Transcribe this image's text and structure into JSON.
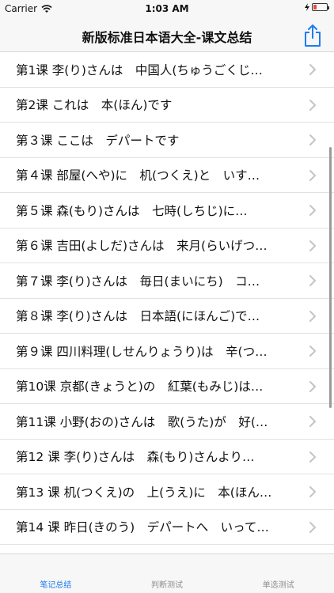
{
  "status": {
    "carrier": "Carrier",
    "time": "1:03 AM"
  },
  "header": {
    "title": "新版标准日本语大全-课文总结",
    "share_icon": "share-icon"
  },
  "lessons": [
    "第1课 李(り)さんは　中国人(ちゅうごくじ…",
    "第2课 これは　本(ほん)です",
    "第３课 ここは　デパートです",
    "第４课 部屋(へや)に　机(つくえ)と　いす…",
    "第５课 森(もり)さんは　七時(しちじ)に…",
    "第６课 吉田(よしだ)さんは　来月(らいげつ…",
    "第７课 李(り)さんは　毎日(まいにち)　コ…",
    "第８课 李(り)さんは　日本語(にほんご)で…",
    "第９课 四川料理(しせんりょうり)は　辛(つ…",
    "第10课 京都(きょうと)の　紅葉(もみじ)は…",
    "第11课 小野(おの)さんは　歌(うた)が　好(…",
    "第12 课 李(り)さんは　森(もり)さんより…",
    "第13 课 机(つくえ)の　上(うえ)に　本(ほん…",
    "第14 课 昨日(きのう)　デパートへ　いって…"
  ],
  "tabs": [
    "笔记总结",
    "判断测试",
    "单选测试"
  ],
  "colors": {
    "accent": "#1e7cf2",
    "inactive": "#8e8e93"
  }
}
